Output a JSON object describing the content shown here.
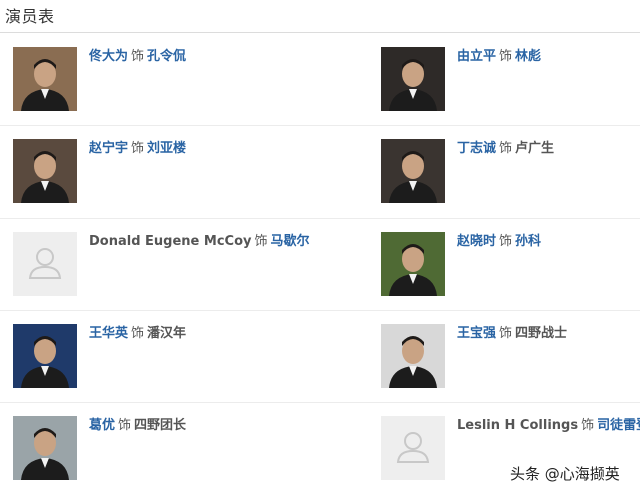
{
  "section": {
    "title": "演员表"
  },
  "cast": [
    {
      "actor": "佟大为",
      "actor_link": true,
      "sep": "饰",
      "role": "孔令侃",
      "role_link": true,
      "photo": "person-photo",
      "bg": "#8a6d52"
    },
    {
      "actor": "由立平",
      "actor_link": true,
      "sep": "饰",
      "role": "林彪",
      "role_link": true,
      "photo": "person-photo",
      "bg": "#2e2a28"
    },
    {
      "actor": "赵宁宇",
      "actor_link": true,
      "sep": "饰",
      "role": "刘亚楼",
      "role_link": true,
      "photo": "person-photo",
      "bg": "#5a4a3e"
    },
    {
      "actor": "丁志诚",
      "actor_link": true,
      "sep": "饰",
      "role": "卢广生",
      "role_link": false,
      "photo": "person-photo",
      "bg": "#3a3430"
    },
    {
      "actor": "Donald Eugene McCoy",
      "actor_link": false,
      "sep": "饰",
      "role": "马歇尔",
      "role_link": true,
      "photo": "placeholder-avatar",
      "bg": "#eeeeee"
    },
    {
      "actor": "赵晓时",
      "actor_link": true,
      "sep": "饰",
      "role": "孙科",
      "role_link": true,
      "photo": "person-photo",
      "bg": "#4f6a34"
    },
    {
      "actor": "王华英",
      "actor_link": true,
      "sep": "饰",
      "role": "潘汉年",
      "role_link": false,
      "photo": "person-photo",
      "bg": "#1f3a6a"
    },
    {
      "actor": "王宝强",
      "actor_link": true,
      "sep": "饰",
      "role": "四野战士",
      "role_link": false,
      "photo": "person-photo",
      "bg": "#d8d8d8"
    },
    {
      "actor": "葛优",
      "actor_link": true,
      "sep": "饰",
      "role": "四野团长",
      "role_link": false,
      "photo": "person-photo",
      "bg": "#9aa4a8"
    },
    {
      "actor": "Leslin H Collings",
      "actor_link": false,
      "sep": "饰",
      "role": "司徒雷登",
      "role_link": true,
      "photo": "placeholder-avatar",
      "bg": "#eeeeee"
    }
  ],
  "watermark": "头条 @心海撷英"
}
